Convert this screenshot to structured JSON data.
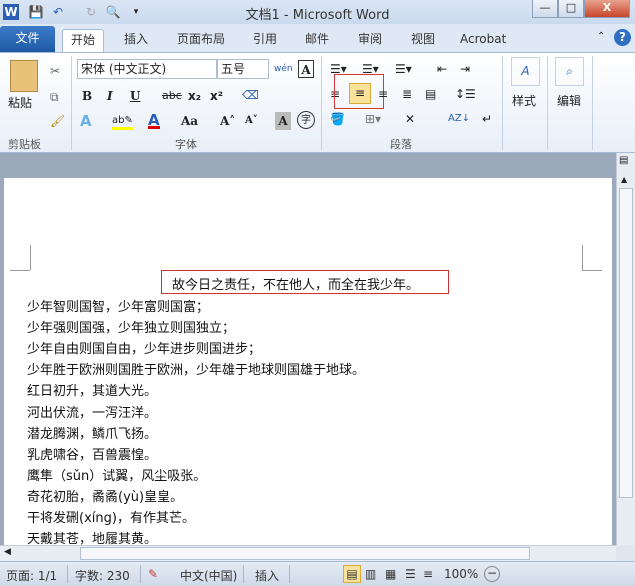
{
  "titlebar": {
    "title": "文档1 - Microsoft Word",
    "app_icon": "W",
    "minimize": "—",
    "maximize": "□",
    "close": "X"
  },
  "tabs": [
    {
      "label": "文件"
    },
    {
      "label": "开始"
    },
    {
      "label": "插入"
    },
    {
      "label": "页面布局"
    },
    {
      "label": "引用"
    },
    {
      "label": "邮件"
    },
    {
      "label": "审阅"
    },
    {
      "label": "视图"
    },
    {
      "label": "Acrobat"
    }
  ],
  "ribbon": {
    "clipboard": {
      "paste": "粘贴",
      "label": "剪贴板"
    },
    "font": {
      "name": "宋体 (中文正文)",
      "size": "五号",
      "bold": "B",
      "italic": "I",
      "underline": "U",
      "strike": "abc",
      "sub": "x₂",
      "sup": "x²",
      "grow": "A˄",
      "shrink": "A˅",
      "case": "Aa",
      "label": "字体",
      "phonetic": "wén",
      "border_char": "A",
      "shade_char": "A",
      "enclose": "字"
    },
    "paragraph": {
      "label": "段落",
      "active_alignment": "center"
    },
    "styles": {
      "label": "样式"
    },
    "editing": {
      "label": "编辑"
    }
  },
  "document": {
    "selected_line": "故今日之责任，不在他人，而全在我少年。",
    "lines": [
      "少年智则国智，少年富则国富；",
      "少年强则国强，少年独立则国独立；",
      "少年自由则国自由，少年进步则国进步；",
      "少年胜于欧洲则国胜于欧洲，少年雄于地球则国雄于地球。",
      "红日初升，其道大光。",
      "河出伏流，一泻汪洋。",
      "潜龙腾渊，鳞爪飞扬。",
      "乳虎啸谷，百兽震惶。",
      "鹰隼（sǔn）试翼，风尘吸张。",
      "奇花初胎，矞矞(yù)皇皇。",
      "干将发硎(xíng)，有作其芒。",
      "天戴其苍，地履其黄。"
    ]
  },
  "status": {
    "page": "页面: 1/1",
    "words": "字数: 230",
    "language": "中文(中国)",
    "mode": "插入",
    "zoom": "100%"
  }
}
